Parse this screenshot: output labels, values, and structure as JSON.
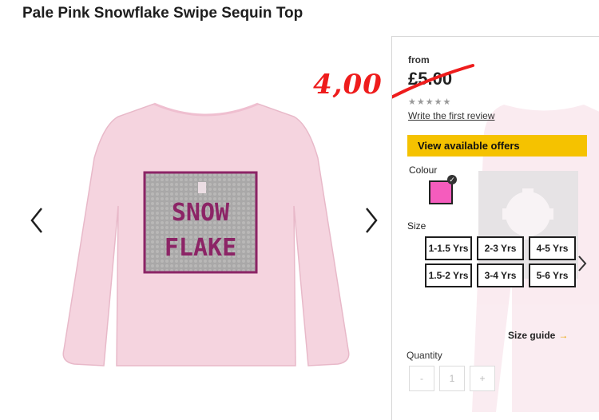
{
  "product": {
    "title": "Pale Pink Snowflake Swipe Sequin Top",
    "image": {
      "top_color": "#f5d4df",
      "sequin_patch_color": "#a9a8a8",
      "sequin_text_color": "#8c2466",
      "sequin_text_line1": "SNOW",
      "sequin_text_line2": "FLAKE"
    }
  },
  "gallery": {
    "prev_icon": "chevron-left-icon",
    "next_icon": "chevron-right-icon"
  },
  "pricing": {
    "from_label": "from",
    "old_price": "£5.00",
    "handwritten_price": "4,00",
    "rating_stars": "★★★★★",
    "review_link": "Write the first review",
    "offers_button": "View available offers",
    "offers_color": "#f5c200",
    "annotation_color": "#ee1c1c"
  },
  "options": {
    "colour_label": "Colour",
    "swatch_color": "#f55cbd",
    "swatch_check": "✓",
    "size_label": "Size",
    "sizes": [
      "1-1.5 Yrs",
      "2-3 Yrs",
      "4-5 Yrs",
      "1.5-2 Yrs",
      "3-4 Yrs",
      "5-6 Yrs"
    ],
    "size_guide": "Size guide",
    "size_guide_arrow": "→"
  },
  "quantity": {
    "label": "Quantity",
    "minus": "-",
    "value": "1",
    "plus": "+"
  }
}
